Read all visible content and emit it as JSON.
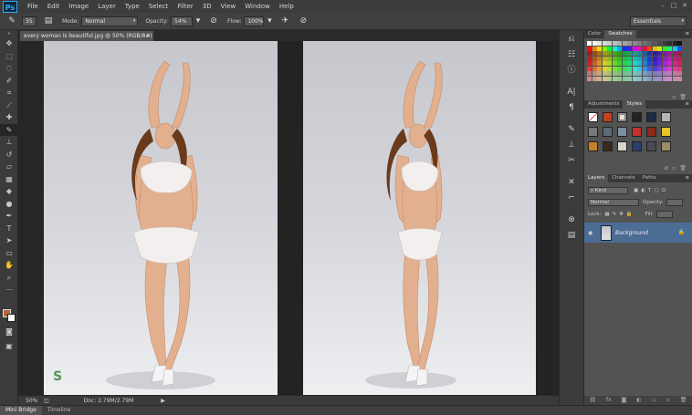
{
  "app": {
    "logo": "Ps"
  },
  "menu": [
    "File",
    "Edit",
    "Image",
    "Layer",
    "Type",
    "Select",
    "Filter",
    "3D",
    "View",
    "Window",
    "Help"
  ],
  "options": {
    "brush_size": "35",
    "mode_label": "Mode:",
    "mode_value": "Normal",
    "opacity_label": "Opacity:",
    "opacity_value": "54%",
    "flow_label": "Flow:",
    "flow_value": "100%",
    "workspace": "Essentials"
  },
  "document": {
    "tab_title": "every woman is beautiful.jpg @ 50% (RGB/8#)",
    "zoom": "50%",
    "doc_info": "Doc: 2.79M/2.79M"
  },
  "bottom_tabs": [
    "Mini Bridge",
    "Timeline"
  ],
  "panels": {
    "color_tabs": [
      "Color",
      "Swatches"
    ],
    "style_tabs": [
      "Adjustments",
      "Styles"
    ],
    "layer_tabs": [
      "Layers",
      "Channels",
      "Paths"
    ],
    "kind_filter": "Kind",
    "blend_mode": "Normal",
    "opacity_label": "Opacity:",
    "lock_label": "Lock:",
    "fill_label": "Fill:",
    "layer_name": "Background"
  },
  "colors": {
    "foreground": "#b8643a",
    "background": "#ffffff",
    "selected_layer": "#4b6c93"
  }
}
